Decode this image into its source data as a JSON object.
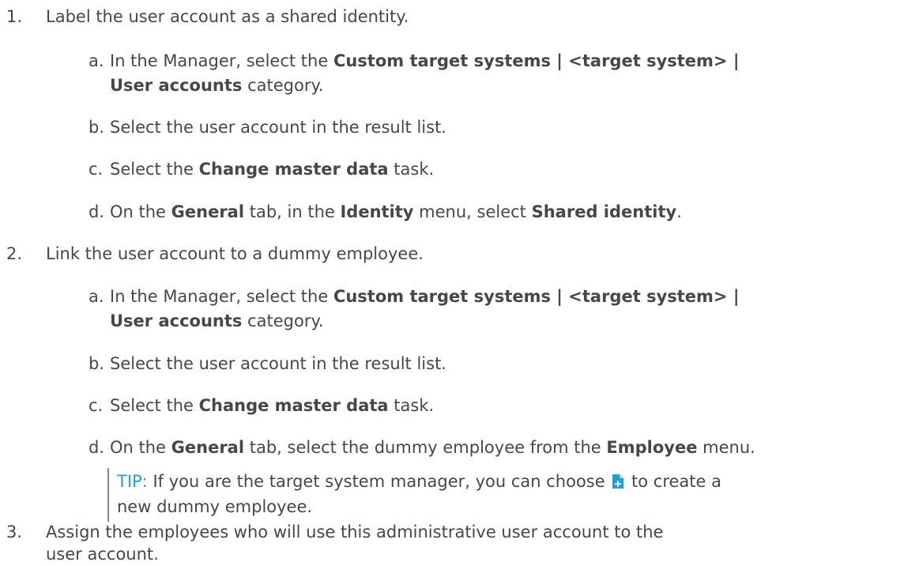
{
  "steps": [
    {
      "num": "1.",
      "text": "Label the user account as a shared identity.",
      "substeps": [
        {
          "letter": "a.",
          "line1": {
            "pre": "In the Manager, select the ",
            "bold": "Custom target systems | <target system> |"
          },
          "line2": {
            "bold": "User accounts",
            "post": " category."
          }
        },
        {
          "letter": "b.",
          "text": "Select the user account in the result list."
        },
        {
          "letter": "c.",
          "pre": "Select the ",
          "bold": "Change master data",
          "post": " task."
        },
        {
          "letter": "d.",
          "pre": "On the ",
          "bold1": "General",
          "mid1": " tab, in the ",
          "bold2": "Identity",
          "mid2": " menu, select ",
          "bold3": "Shared identity",
          "post": "."
        }
      ]
    },
    {
      "num": "2.",
      "text": "Link the user account to a dummy employee.",
      "substeps": [
        {
          "letter": "a.",
          "line1": {
            "pre": "In the Manager, select the ",
            "bold": "Custom target systems | <target system> |"
          },
          "line2": {
            "bold": "User accounts",
            "post": " category."
          }
        },
        {
          "letter": "b.",
          "text": "Select the user account in the result list."
        },
        {
          "letter": "c.",
          "pre": "Select the ",
          "bold": "Change master data",
          "post": " task."
        },
        {
          "letter": "d.",
          "pre": "On the ",
          "bold1": "General",
          "mid1": " tab, select the dummy employee from the ",
          "bold2": "Employee",
          "post": " menu."
        }
      ],
      "tip": {
        "label": "TIP:",
        "line1_pre": " If you are the target system manager, you can choose ",
        "icon": "add-document-icon",
        "line1_post": " to create a",
        "line2": "new dummy employee."
      }
    },
    {
      "num": "3.",
      "line1": "Assign the employees who will use this administrative user account to the",
      "line2": "user account."
    }
  ],
  "colors": {
    "text": "#474747",
    "tip": "#1aa1e0",
    "icon": "#1aa1e0"
  }
}
